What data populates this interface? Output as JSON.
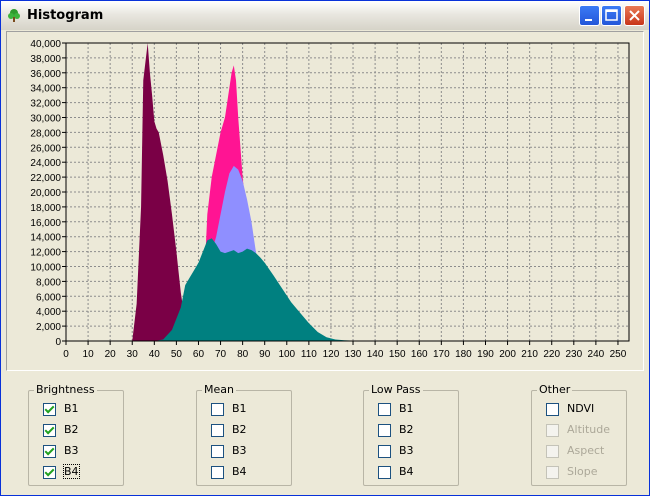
{
  "window": {
    "title": "Histogram"
  },
  "colors": {
    "b1": "#7a0046",
    "b2": "#ff1493",
    "b3": "#8f8fff",
    "b4": "#008080",
    "plot_bg": "#ece9d8",
    "grid": "#8c8c8c"
  },
  "chart_data": {
    "type": "area",
    "title": "",
    "xlabel": "",
    "ylabel": "",
    "xlim": [
      0,
      255
    ],
    "ylim": [
      0,
      40000
    ],
    "grid": true,
    "x_ticks": [
      0,
      10,
      20,
      30,
      40,
      50,
      60,
      70,
      80,
      90,
      100,
      110,
      120,
      130,
      140,
      150,
      160,
      170,
      180,
      190,
      200,
      210,
      220,
      230,
      240,
      250
    ],
    "y_ticks": [
      0,
      2000,
      4000,
      6000,
      8000,
      10000,
      12000,
      14000,
      16000,
      18000,
      20000,
      22000,
      24000,
      26000,
      28000,
      30000,
      32000,
      34000,
      36000,
      38000,
      40000
    ],
    "x_tick_labels": [
      "0",
      "10",
      "20",
      "30",
      "40",
      "50",
      "60",
      "70",
      "80",
      "90",
      "100",
      "110",
      "120",
      "130",
      "140",
      "150",
      "160",
      "170",
      "180",
      "190",
      "200",
      "210",
      "220",
      "230",
      "240",
      "250"
    ],
    "y_tick_labels": [
      "0",
      "2,000",
      "4,000",
      "6,000",
      "8,000",
      "10,000",
      "12,000",
      "14,000",
      "16,000",
      "18,000",
      "20,000",
      "22,000",
      "24,000",
      "26,000",
      "28,000",
      "30,000",
      "32,000",
      "34,000",
      "36,000",
      "38,000",
      "40,000"
    ],
    "series": [
      {
        "name": "B1",
        "color": "#7a0046",
        "x": [
          30,
          32,
          34,
          35,
          36,
          37,
          38,
          39,
          40,
          41,
          42,
          44,
          46,
          48,
          50,
          52,
          54,
          56,
          58
        ],
        "values": [
          0,
          5000,
          18000,
          35000,
          37500,
          40000,
          36000,
          33000,
          29500,
          28500,
          28000,
          25000,
          21500,
          17000,
          12000,
          6500,
          2500,
          500,
          0
        ]
      },
      {
        "name": "B2",
        "color": "#ff1493",
        "x": [
          60,
          62,
          64,
          66,
          68,
          70,
          72,
          74,
          75,
          76,
          77,
          78,
          80,
          82,
          84,
          86,
          88
        ],
        "values": [
          0,
          4000,
          17000,
          22000,
          25000,
          28000,
          30000,
          34000,
          36000,
          37000,
          35000,
          30000,
          22000,
          16000,
          10000,
          3000,
          0
        ]
      },
      {
        "name": "B3",
        "color": "#8f8fff",
        "x": [
          62,
          64,
          66,
          68,
          70,
          72,
          74,
          76,
          78,
          80,
          82,
          84,
          86,
          88,
          90,
          92,
          94
        ],
        "values": [
          0,
          6000,
          12000,
          14000,
          17000,
          20000,
          22500,
          23500,
          23000,
          21500,
          19000,
          16000,
          12000,
          9000,
          6000,
          2000,
          0
        ]
      },
      {
        "name": "B4",
        "color": "#008080",
        "x": [
          40,
          44,
          48,
          52,
          54,
          56,
          58,
          60,
          62,
          64,
          66,
          68,
          70,
          72,
          74,
          76,
          78,
          80,
          82,
          84,
          86,
          88,
          90,
          94,
          98,
          102,
          106,
          110,
          114,
          118,
          122,
          126,
          130,
          134,
          138
        ],
        "values": [
          0,
          200,
          1500,
          4500,
          7500,
          8500,
          9500,
          10500,
          12000,
          13500,
          13800,
          13000,
          12000,
          11800,
          12000,
          12200,
          11800,
          12000,
          12400,
          12200,
          11800,
          11200,
          10500,
          8800,
          7000,
          5200,
          3800,
          2400,
          1200,
          500,
          200,
          100,
          50,
          0,
          0
        ]
      }
    ]
  },
  "groups": [
    {
      "title": "Brightness",
      "items": [
        {
          "label": "B1",
          "checked": true,
          "disabled": false
        },
        {
          "label": "B2",
          "checked": true,
          "disabled": false
        },
        {
          "label": "B3",
          "checked": true,
          "disabled": false
        },
        {
          "label": "B4",
          "checked": true,
          "disabled": false,
          "focused": true
        }
      ]
    },
    {
      "title": "Mean",
      "items": [
        {
          "label": "B1",
          "checked": false,
          "disabled": false
        },
        {
          "label": "B2",
          "checked": false,
          "disabled": false
        },
        {
          "label": "B3",
          "checked": false,
          "disabled": false
        },
        {
          "label": "B4",
          "checked": false,
          "disabled": false
        }
      ]
    },
    {
      "title": "Low Pass",
      "items": [
        {
          "label": "B1",
          "checked": false,
          "disabled": false
        },
        {
          "label": "B2",
          "checked": false,
          "disabled": false
        },
        {
          "label": "B3",
          "checked": false,
          "disabled": false
        },
        {
          "label": "B4",
          "checked": false,
          "disabled": false
        }
      ]
    },
    {
      "title": "Other",
      "items": [
        {
          "label": "NDVI",
          "checked": false,
          "disabled": false
        },
        {
          "label": "Altitude",
          "checked": false,
          "disabled": true
        },
        {
          "label": "Aspect",
          "checked": false,
          "disabled": true
        },
        {
          "label": "Slope",
          "checked": false,
          "disabled": true
        }
      ]
    }
  ]
}
